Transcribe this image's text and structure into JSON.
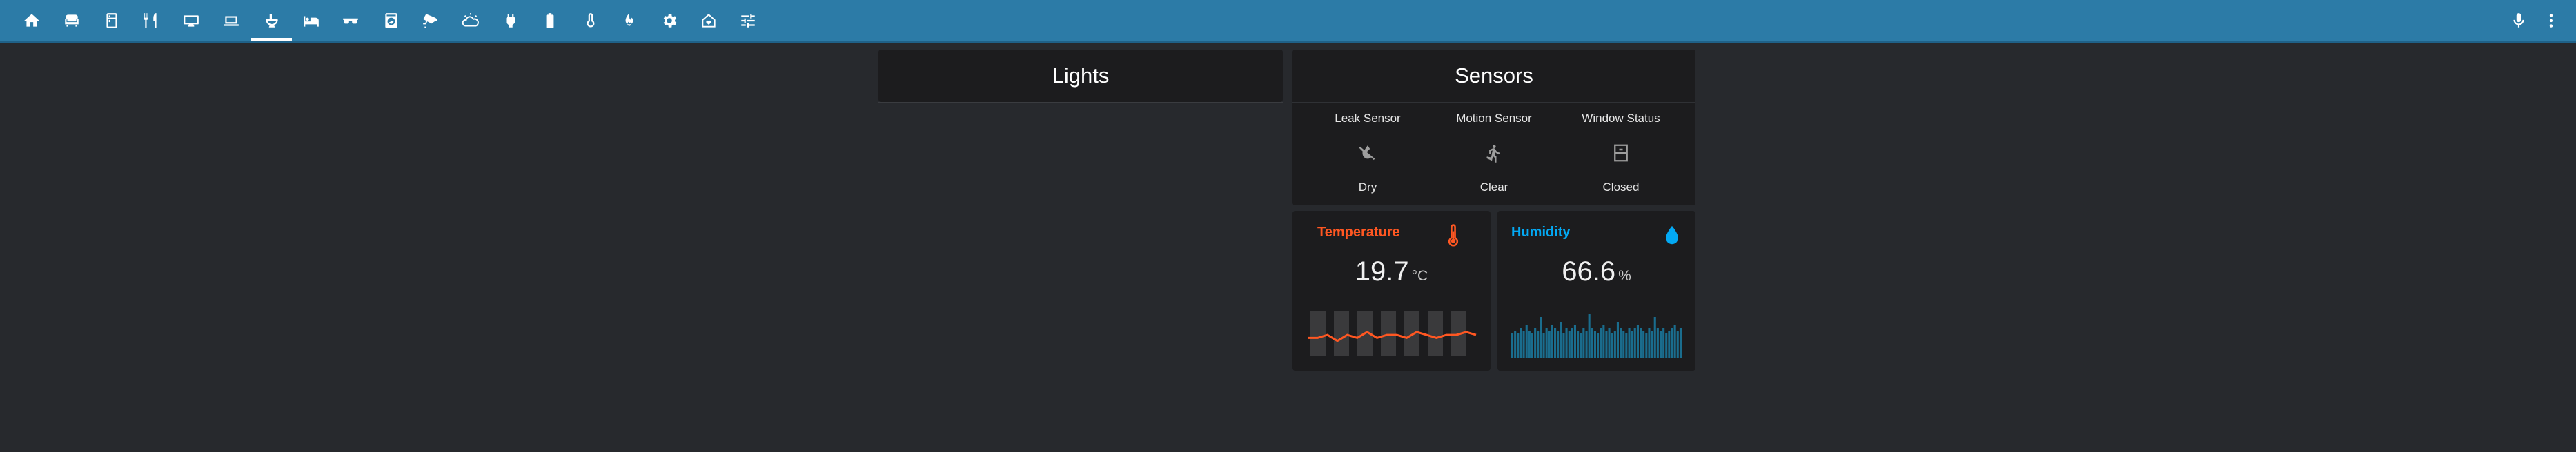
{
  "topbar": {
    "nav_items": [
      {
        "name": "home",
        "icon": "home-icon"
      },
      {
        "name": "living-room",
        "icon": "sofa-icon"
      },
      {
        "name": "fridge",
        "icon": "fridge-icon"
      },
      {
        "name": "kitchen",
        "icon": "food-icon"
      },
      {
        "name": "media",
        "icon": "tv-icon"
      },
      {
        "name": "office",
        "icon": "laptop-icon"
      },
      {
        "name": "bathroom",
        "icon": "toilet-icon"
      },
      {
        "name": "bedroom",
        "icon": "bed-icon"
      },
      {
        "name": "vr",
        "icon": "glasses-icon"
      },
      {
        "name": "laundry",
        "icon": "washing-machine-icon"
      },
      {
        "name": "security",
        "icon": "cctv-icon"
      },
      {
        "name": "weather",
        "icon": "weather-icon"
      },
      {
        "name": "power",
        "icon": "plug-icon"
      },
      {
        "name": "battery",
        "icon": "battery-icon"
      },
      {
        "name": "climate",
        "icon": "thermometer-icon"
      },
      {
        "name": "fire",
        "icon": "fire-icon"
      },
      {
        "name": "settings",
        "icon": "gear-icon"
      },
      {
        "name": "house",
        "icon": "home-heart-icon"
      },
      {
        "name": "controls",
        "icon": "tune-icon"
      }
    ],
    "active_index": 6,
    "right_icons": [
      "microphone-icon",
      "more-vertical-icon"
    ]
  },
  "lights_card": {
    "title": "Lights"
  },
  "sensors_card": {
    "title": "Sensors",
    "sensors": [
      {
        "name": "Leak Sensor",
        "state": "Dry",
        "icon": "water-off-icon"
      },
      {
        "name": "Motion Sensor",
        "state": "Clear",
        "icon": "walk-icon"
      },
      {
        "name": "Window Status",
        "state": "Closed",
        "icon": "window-closed-icon"
      }
    ]
  },
  "temperature_card": {
    "title": "Temperature",
    "value": "19.7",
    "unit": "°C",
    "color": "#ff5722",
    "icon": "thermometer-icon",
    "trend": [
      19.6,
      19.6,
      19.7,
      19.5,
      19.7,
      19.6,
      19.8,
      19.6,
      19.7,
      19.7,
      19.6,
      19.8,
      19.7,
      19.6,
      19.7,
      19.7,
      19.8,
      19.7
    ]
  },
  "humidity_card": {
    "title": "Humidity",
    "value": "66.6",
    "unit": "%",
    "color": "#03a9f4",
    "icon": "water-drop-icon",
    "trend": [
      64,
      65,
      64,
      66,
      65,
      67,
      65,
      64,
      66,
      65,
      70,
      64,
      66,
      65,
      67,
      66,
      65,
      68,
      64,
      66,
      65,
      66,
      67,
      65,
      64,
      66,
      65,
      71,
      66,
      65,
      64,
      66,
      67,
      65,
      66,
      64,
      65,
      68,
      66,
      65,
      64,
      66,
      65,
      66,
      67,
      66,
      65,
      64,
      66,
      65,
      70,
      66,
      65,
      66,
      64,
      65,
      66,
      67,
      65,
      66
    ]
  },
  "colors": {
    "header": "#2c7ba7",
    "background": "#27292d",
    "card": "#1c1c1e"
  }
}
